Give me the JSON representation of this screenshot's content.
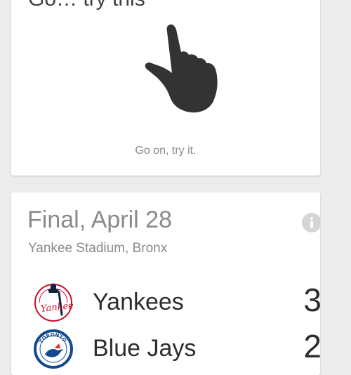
{
  "gesture_card": {
    "title": "Go… try this",
    "icon": "swipe-up-hand-icon",
    "hint": "Go on, try it."
  },
  "score_card": {
    "status_date": "Final, April 28",
    "venue": "Yankee Stadium, Bronx",
    "info_icon": "info-icon",
    "teams": [
      {
        "name": "Yankees",
        "score": "3",
        "logo": "yankees-logo",
        "logo_text": "Yankees"
      },
      {
        "name": "Blue Jays",
        "score": "2",
        "logo": "blue-jays-logo",
        "logo_text": "TORONTO"
      }
    ]
  },
  "colors": {
    "background": "#ececec",
    "card": "#ffffff",
    "primary_text": "#2d2d2d",
    "secondary_text": "#8a8a8a",
    "yankees_red": "#c8102e",
    "yankees_navy": "#0c2340",
    "blue_jays_blue": "#134a8e",
    "blue_jays_red": "#e8291c"
  }
}
